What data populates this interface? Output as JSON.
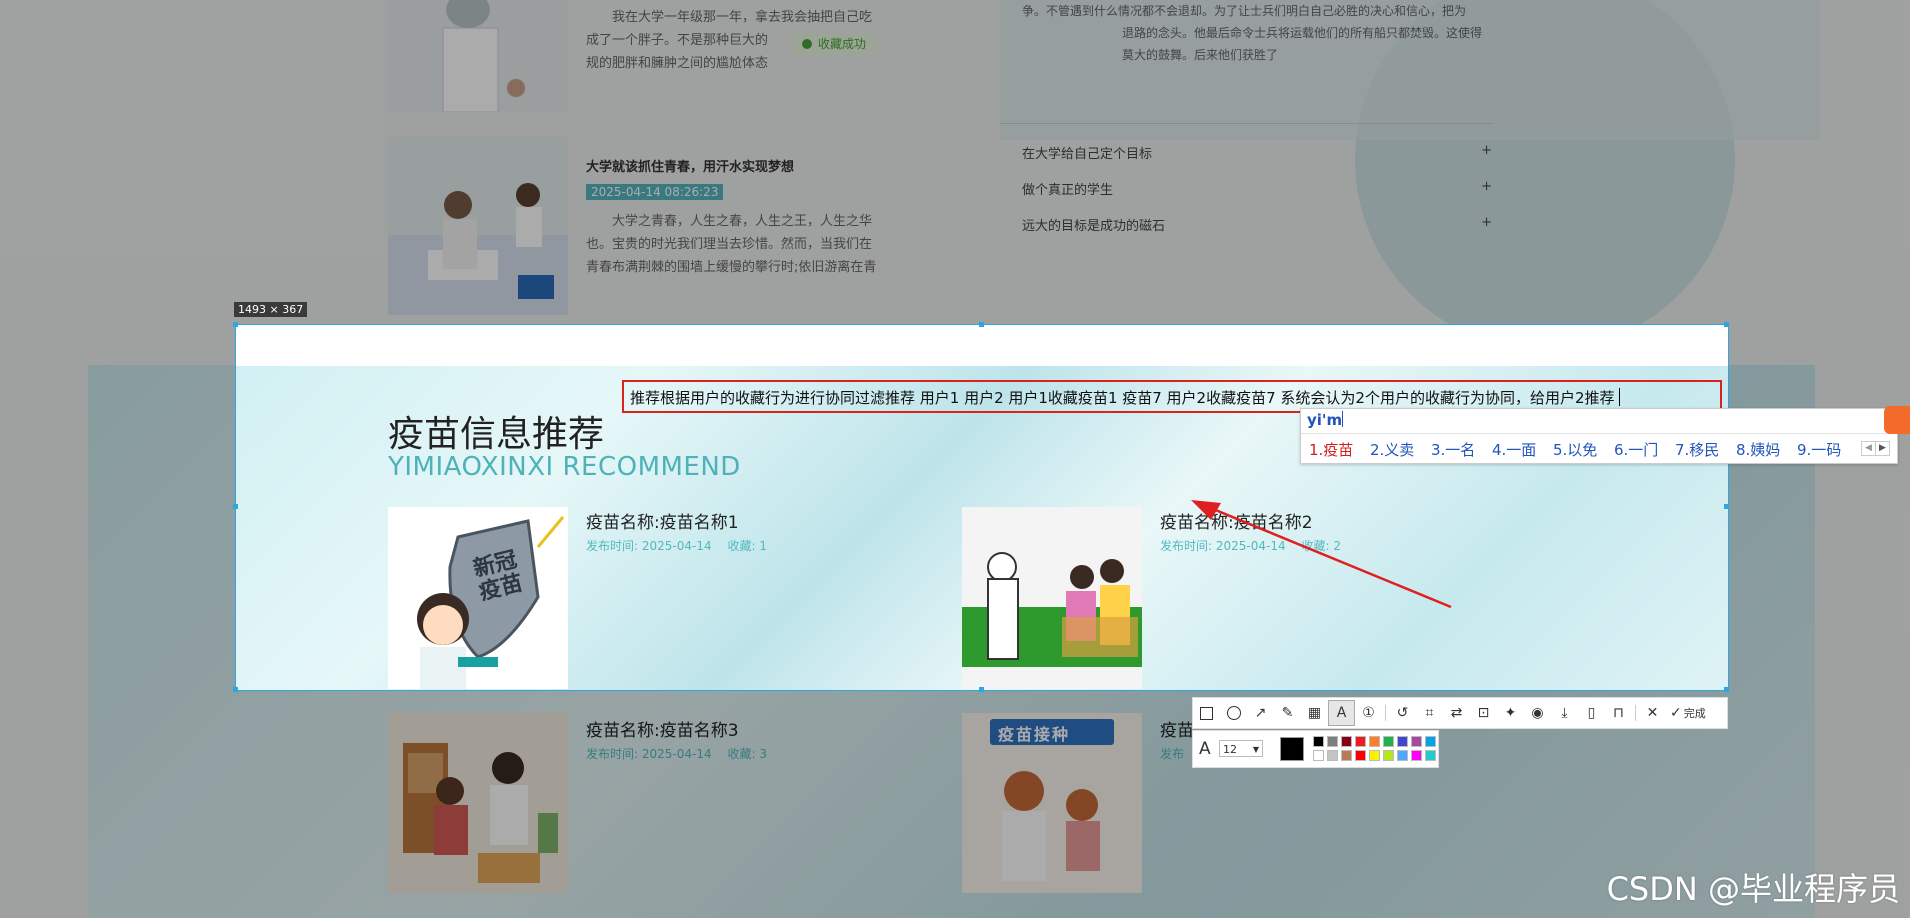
{
  "background": {
    "news": [
      {
        "title": "",
        "date": "",
        "body_lines": [
          "我在大学一年级那一年，拿去我会抽把自己吃",
          "成了一个胖子。不是那种巨大的",
          "规的肥胖和臃肿之间的尴尬体态"
        ]
      },
      {
        "title": "大学就该抓住青春，用汗水实现梦想",
        "date": "2025-04-14 08:26:23",
        "body_lines": [
          "大学之青春，人生之春，人生之王，人生之华",
          "也。宝贵的时光我们理当去珍惜。然而，当我们在",
          "青春布满荆棘的围墙上缓慢的攀行时;依旧游离在青"
        ]
      }
    ],
    "toast": "收藏成功",
    "right_text_lines": [
      "争。不管遇到什么情况都不会退却。为了让士兵们明白自己必胜的决心和信心，把为",
      "退路的念头。他最后命令士兵将运载他们的所有船只都焚毁。这使得",
      "莫大的鼓舞。后来他们获胜了"
    ],
    "accordion": [
      {
        "label": "在大学给自己定个目标",
        "icon": "+"
      },
      {
        "label": "做个真正的学生",
        "icon": "+"
      },
      {
        "label": "远大的目标是成功的磁石",
        "icon": "+"
      }
    ],
    "lower_cards": [
      {
        "name": "疫苗名称:疫苗名称3",
        "date_label": "发布时间:",
        "date": "2025-04-14",
        "fav_label": "收藏:",
        "fav": "3"
      },
      {
        "name": "疫苗",
        "date_label": "发布",
        "date": "",
        "fav_label": "",
        "fav": ""
      }
    ],
    "lower_image_caption": "疫苗接种"
  },
  "capture": {
    "size_label": "1493 × 367",
    "section_title": "疫苗信息推荐",
    "section_subtitle": "YIMIAOXINXI RECOMMEND",
    "cards": [
      {
        "name": "疫苗名称:疫苗名称1",
        "date_label": "发布时间:",
        "date": "2025-04-14",
        "fav_label": "收藏:",
        "fav": "1",
        "image_label": "新冠疫苗"
      },
      {
        "name": "疫苗名称:疫苗名称2",
        "date_label": "发布时间:",
        "date": "2025-04-14",
        "fav_label": "收藏:",
        "fav": "2",
        "image_label": ""
      }
    ],
    "annotation_text": "推荐根据用户的收藏行为进行协同过滤推荐 用户1 用户2 用户1收藏疫苗1 疫苗7 用户2收藏疫苗7 系统会认为2个用户的收藏行为协同，给用户2推荐"
  },
  "ime": {
    "input": "yi'm",
    "candidates": [
      "1.疫苗",
      "2.义卖",
      "3.一名",
      "4.一面",
      "5.以免",
      "6.一门",
      "7.移民",
      "8.姨妈",
      "9.一码"
    ]
  },
  "toolbar": {
    "done_label": "完成",
    "font_size": "12",
    "tools": [
      "rectangle-icon",
      "ellipse-icon",
      "arrow-icon",
      "pen-icon",
      "mosaic-icon",
      "text-icon",
      "number-icon",
      "undo-icon",
      "ocr-icon",
      "translate-icon",
      "scan-icon",
      "pin-icon",
      "record-icon",
      "save-icon",
      "phone-icon",
      "bookmark-icon",
      "close-icon",
      "check-icon"
    ],
    "swatch_colors": [
      "#000000",
      "#7f7f7f",
      "#880015",
      "#ed1c24",
      "#ff7f27",
      "#22b14c",
      "#3f48cc",
      "#a349a4",
      "#00a2e8",
      "#ffffff",
      "#c3c3c3",
      "#b97a57",
      "#ff0000",
      "#fff200",
      "#b5e61d",
      "#4fa6ff",
      "#ff00ff",
      "#22cccc"
    ],
    "current_color": "#000000"
  },
  "watermark": "CSDN @毕业程序员"
}
